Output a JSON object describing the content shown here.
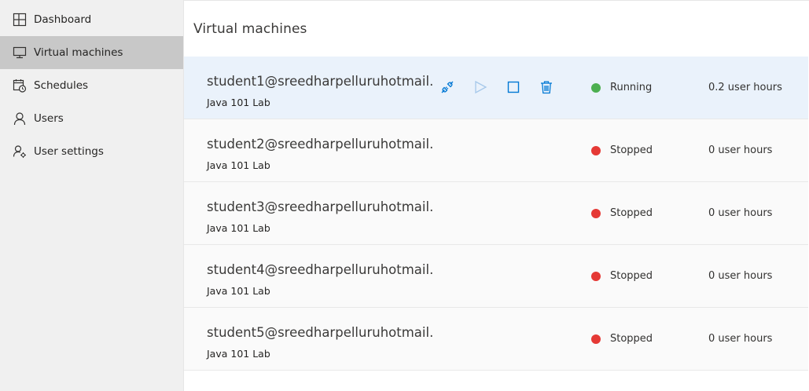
{
  "sidebar": {
    "items": [
      {
        "label": "Dashboard",
        "icon": "dashboard-icon"
      },
      {
        "label": "Virtual machines",
        "icon": "monitor-icon",
        "active": true
      },
      {
        "label": "Schedules",
        "icon": "calendar-clock-icon"
      },
      {
        "label": "Users",
        "icon": "user-icon"
      },
      {
        "label": "User settings",
        "icon": "user-settings-icon"
      }
    ]
  },
  "main": {
    "title": "Virtual machines",
    "vms": [
      {
        "name": "student1@sreedharpelluruhotmail....",
        "lab": "Java 101 Lab",
        "status": "Running",
        "hours": "0.2 user hours",
        "selected": true
      },
      {
        "name": "student2@sreedharpelluruhotmail....",
        "lab": "Java 101 Lab",
        "status": "Stopped",
        "hours": "0 user hours"
      },
      {
        "name": "student3@sreedharpelluruhotmail....",
        "lab": "Java 101 Lab",
        "status": "Stopped",
        "hours": "0 user hours"
      },
      {
        "name": "student4@sreedharpelluruhotmail...",
        "lab": "Java 101 Lab",
        "status": "Stopped",
        "hours": "0 user hours"
      },
      {
        "name": "student5@sreedharpelluruhotmail....",
        "lab": "Java 101 Lab",
        "status": "Stopped",
        "hours": "0 user hours"
      }
    ],
    "row_actions": [
      "connect-icon",
      "start-icon",
      "stop-icon",
      "delete-icon"
    ]
  },
  "colors": {
    "accent": "#0078d4",
    "running": "#4caf50",
    "stopped": "#e53935",
    "disabled_icon": "#a6c8ea",
    "sidebar_bg": "#f0f0f0",
    "sidebar_active": "#c8c8c8",
    "selected_row": "#eaf2fb"
  }
}
